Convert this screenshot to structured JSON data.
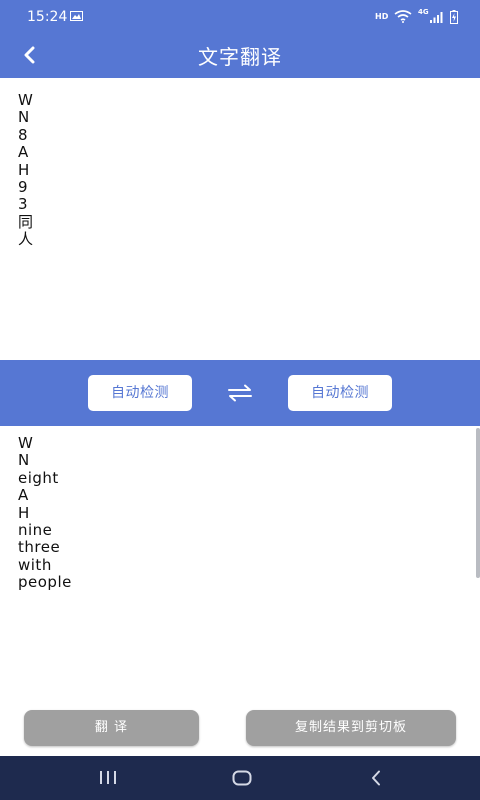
{
  "status_bar": {
    "time": "15:24",
    "hd_label": "HD",
    "network_label": "4G"
  },
  "app_bar": {
    "title": "文字翻译"
  },
  "source_text": [
    "W",
    "N",
    "8",
    "A",
    "H",
    "9",
    "3",
    "同",
    "人"
  ],
  "language_bar": {
    "source_language": "自动检测",
    "target_language": "自动检测"
  },
  "result_text": [
    "W",
    "N",
    "eight",
    "A",
    "H",
    "nine",
    "three",
    "with",
    "people"
  ],
  "actions": {
    "translate_label": "翻 译",
    "copy_label": "复制结果到剪切板"
  },
  "colors": {
    "primary": "#5677d3",
    "button_disabled": "#a0a0a0",
    "nav_bar": "#1e2a4e"
  }
}
